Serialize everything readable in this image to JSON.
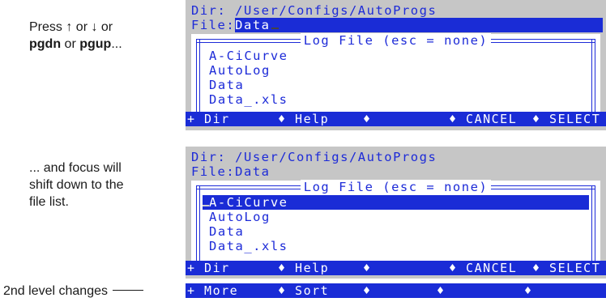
{
  "captions": {
    "c1_line1": "Press ↑ or ↓ or",
    "c1_pgdn": "pgdn",
    "c1_or": " or ",
    "c1_pgup": "pgup",
    "c1_end": "...",
    "c2_line1": "... and focus will",
    "c2_line2": "shift down to the",
    "c2_line3": "file list.",
    "c3": "2nd level changes"
  },
  "screen1": {
    "dir_line": "Dir: /User/Configs/AutoProgs",
    "file_label": "File:",
    "file_value": "Data",
    "box_title": "Log File (esc = none)",
    "files": [
      "A-CiCurve",
      "AutoLog",
      "Data",
      "Data_.xls"
    ]
  },
  "screen2": {
    "dir_line": "Dir: /User/Configs/AutoProgs",
    "file_line": "File:Data",
    "box_title": "Log File (esc = none)",
    "files": [
      "A-CiCurve",
      "AutoLog",
      "Data",
      "Data_.xls"
    ],
    "selected_index": 0
  },
  "keybar_level1": {
    "k1": "+ Dir",
    "k2": "♦ Help",
    "k3": "♦",
    "k4": "♦ CANCEL",
    "k5": "♦ SELECT"
  },
  "keybar_level2": {
    "k1": "+ More",
    "k2": "♦ Sort",
    "k3": "♦",
    "k4": "♦",
    "k5": "♦"
  },
  "colors": {
    "terminal_bg": "#c6c6c6",
    "text_blue": "#1d2bd8",
    "highlight_blue": "#1a2cd6"
  }
}
